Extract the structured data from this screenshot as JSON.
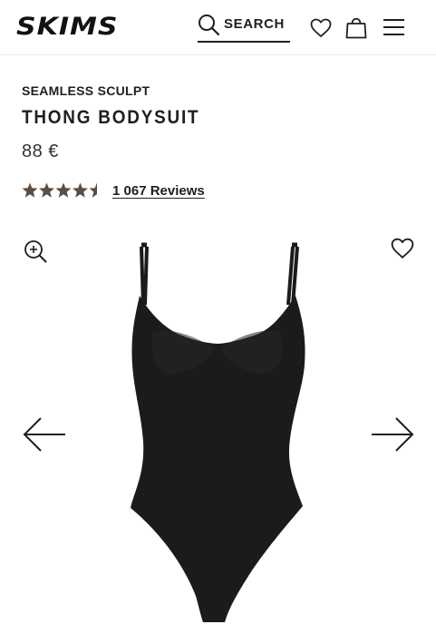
{
  "header": {
    "logo": "SKIMS",
    "search_label": "SEARCH"
  },
  "product": {
    "collection": "SEAMLESS SCULPT",
    "name": "THONG BODYSUIT",
    "price": "88 €",
    "rating": 4.5,
    "reviews_label": "1 067 Reviews"
  },
  "colors": {
    "text": "#1f1f1f",
    "stars": "#5a4d43",
    "garment": "#1b1b1b"
  },
  "icons": {
    "search": "search-icon",
    "wishlist": "heart-icon",
    "bag": "shopping-bag-icon",
    "menu": "hamburger-menu-icon",
    "zoom": "zoom-in-icon",
    "prev": "arrow-left-icon",
    "next": "arrow-right-icon"
  }
}
